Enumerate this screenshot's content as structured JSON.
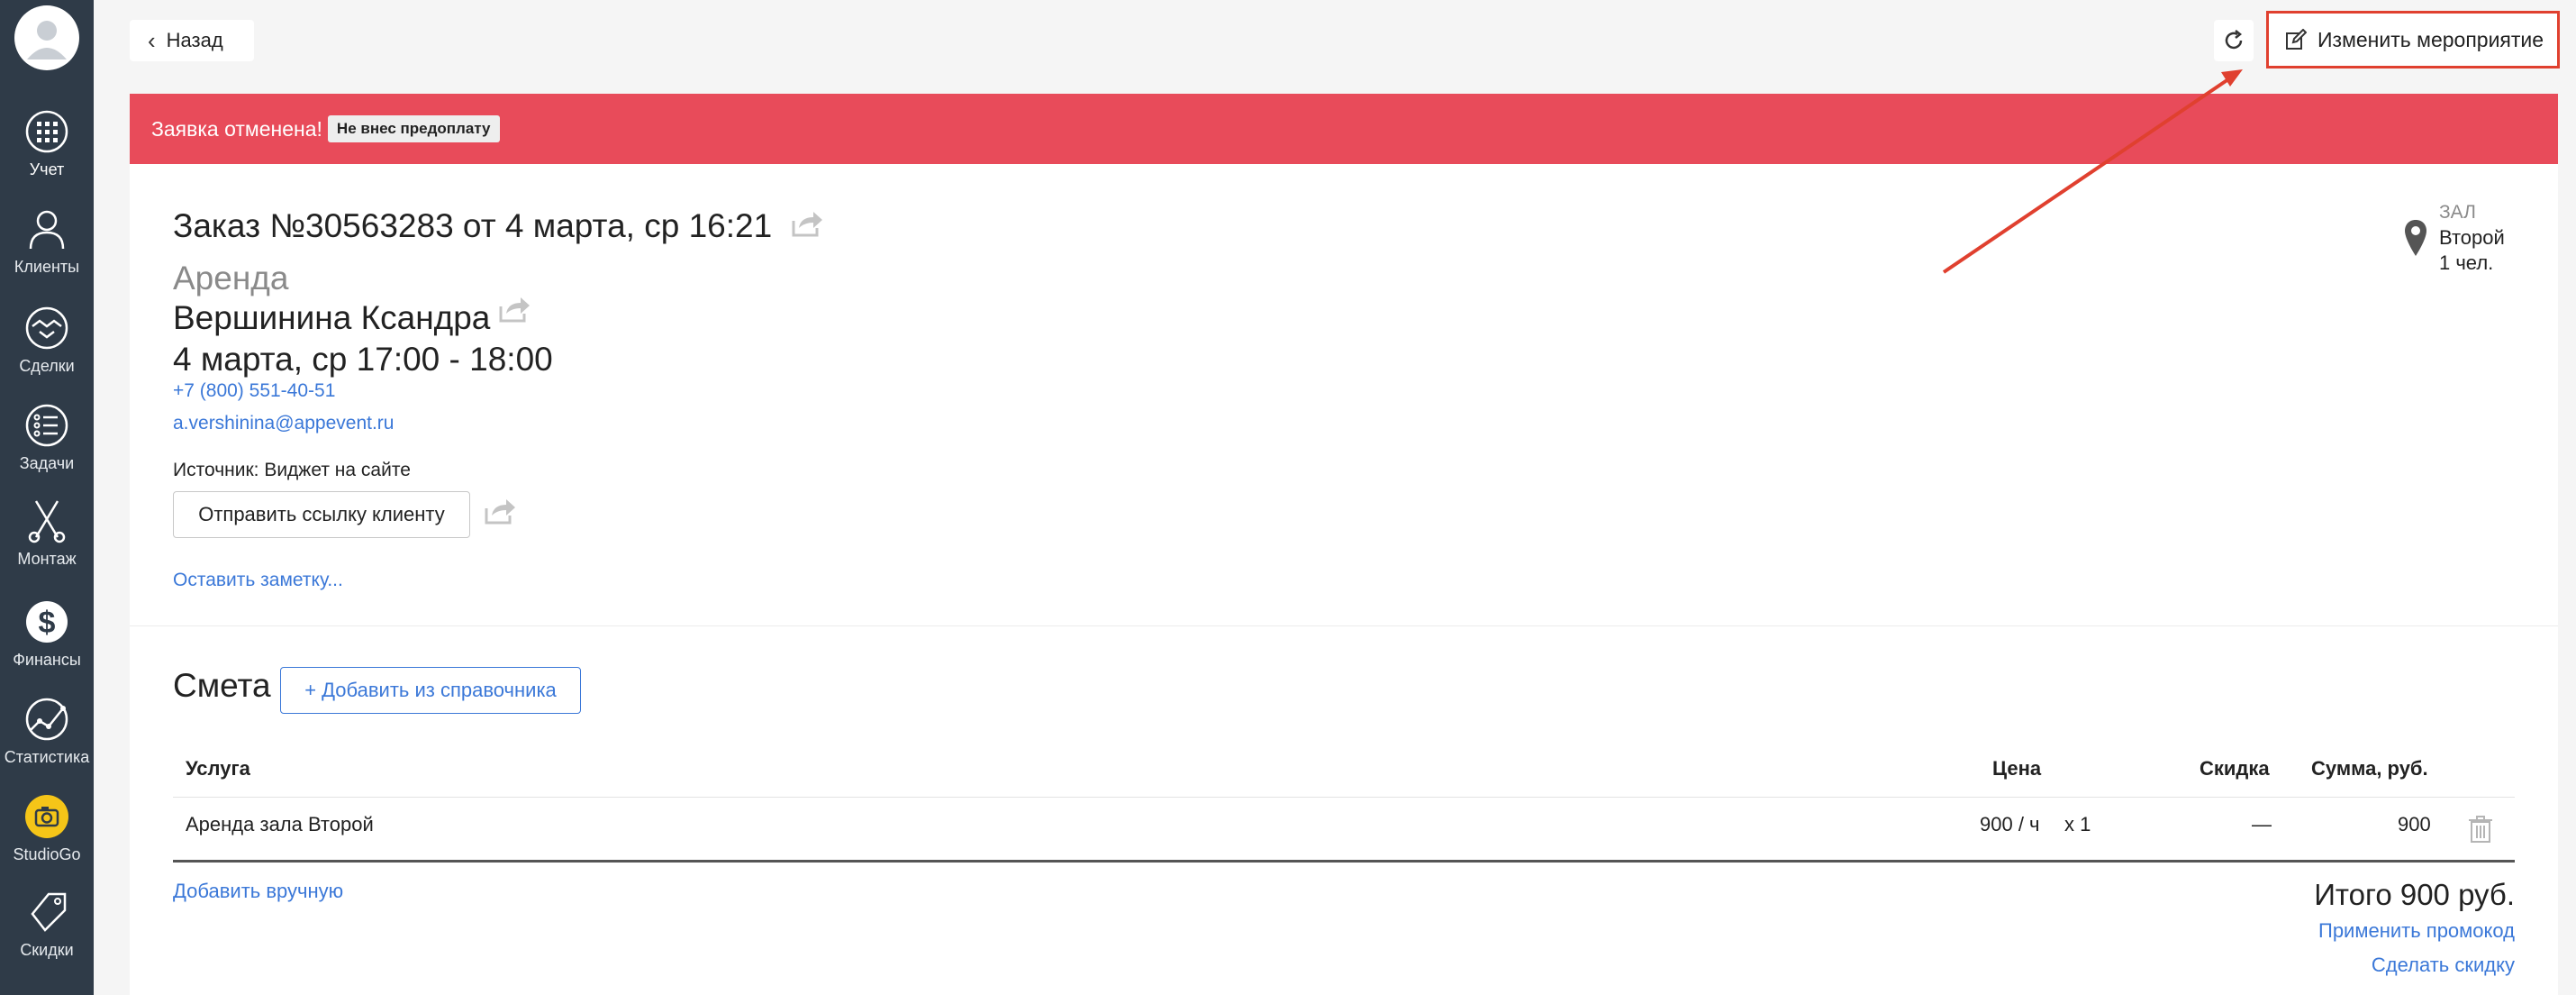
{
  "sidebar": {
    "items": [
      {
        "label": "Учет",
        "icon": "calendar-icon"
      },
      {
        "label": "Клиенты",
        "icon": "user-icon"
      },
      {
        "label": "Сделки",
        "icon": "handshake-icon"
      },
      {
        "label": "Задачи",
        "icon": "tasks-icon"
      },
      {
        "label": "Монтаж",
        "icon": "scissors-icon"
      },
      {
        "label": "Финансы",
        "icon": "dollar-icon"
      },
      {
        "label": "Статистика",
        "icon": "chart-icon"
      },
      {
        "label": "StudioGo",
        "icon": "camera-icon"
      },
      {
        "label": "Скидки",
        "icon": "sale-tag-icon"
      }
    ]
  },
  "topbar": {
    "back_label": "Назад",
    "edit_label": "Изменить мероприятие"
  },
  "banner": {
    "text": "Заявка отменена!",
    "badge": "Не внес предоплату",
    "color": "#e84b5a"
  },
  "order": {
    "title": "Заказ №30563283 от 4 марта, ср 16:21",
    "type": "Аренда",
    "client": "Вершинина Ксандра",
    "datetime": "4 марта, ср 17:00 - 18:00",
    "phone": "+7 (800) 551-40-51",
    "email": "a.vershinina@appevent.ru",
    "source": "Источник: Виджет на сайте",
    "send_link_label": "Отправить ссылку клиенту",
    "note_link": "Оставить заметку..."
  },
  "hall": {
    "label": "ЗАЛ",
    "name": "Второй",
    "people": "1 чел."
  },
  "estimate": {
    "title": "Смета",
    "add_ref_label": "+ Добавить из справочника",
    "columns": {
      "service": "Услуга",
      "price": "Цена",
      "discount": "Скидка",
      "sum": "Сумма, руб."
    },
    "rows": [
      {
        "service": "Аренда зала Второй",
        "price": "900 / ч",
        "qty": "x 1",
        "discount": "—",
        "sum": "900"
      }
    ],
    "add_manual_label": "Добавить вручную",
    "total": "Итого 900 руб.",
    "promo_label": "Применить промокод",
    "discount_label": "Сделать скидку"
  },
  "colors": {
    "accent": "#3b78d8",
    "sidebar": "#2f3b48",
    "highlight": "#e0402f"
  }
}
